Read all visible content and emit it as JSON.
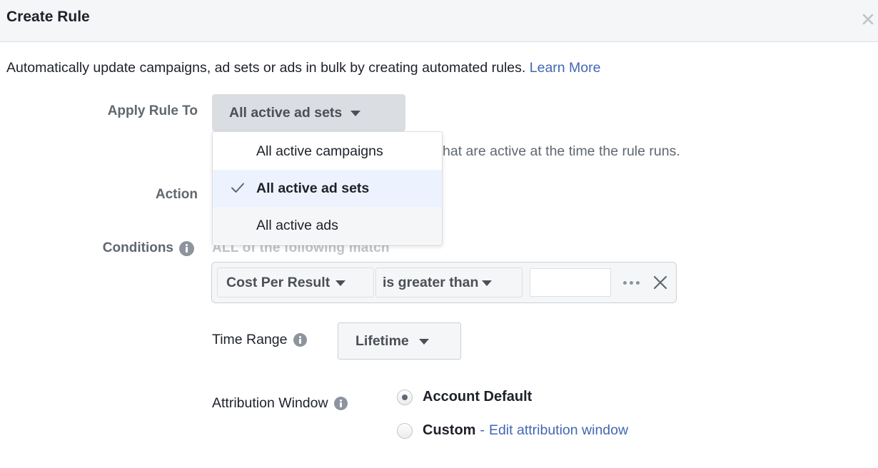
{
  "dialog": {
    "title": "Create Rule",
    "close_icon": "close-icon"
  },
  "description": {
    "text": "Automatically update campaigns, ad sets or ads in bulk by creating automated rules.",
    "link_label": "Learn More"
  },
  "apply_rule": {
    "label": "Apply Rule To",
    "selected": "All active ad sets",
    "helper_text_visible": "hat are active at the time the rule runs.",
    "menu": {
      "open": true,
      "items": [
        {
          "label": "All active campaigns",
          "selected": false
        },
        {
          "label": "All active ad sets",
          "selected": true
        },
        {
          "label": "All active ads",
          "selected": false
        }
      ]
    }
  },
  "action": {
    "label": "Action"
  },
  "conditions": {
    "label": "Conditions",
    "match_text": "ALL of the following match",
    "rows": [
      {
        "metric": "Cost Per Result",
        "operator": "is greater than",
        "value": "",
        "value_placeholder": ""
      }
    ]
  },
  "time_range": {
    "label": "Time Range",
    "selected": "Lifetime"
  },
  "attribution_window": {
    "label": "Attribution Window",
    "options": [
      {
        "label": "Account Default",
        "checked": true
      },
      {
        "label": "Custom",
        "checked": false,
        "separator": "-",
        "link_label": "Edit attribution window"
      }
    ]
  },
  "colors": {
    "link": "#4267b2",
    "header_bg": "#f5f6f7",
    "selected_item_bg": "#ecf3ff",
    "apply_button_bg": "#dadde1"
  }
}
